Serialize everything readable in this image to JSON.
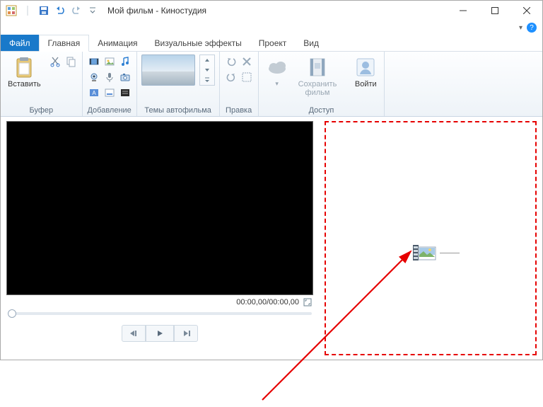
{
  "window": {
    "title": "Мой фильм - Киностудия"
  },
  "tabs": {
    "file": "Файл",
    "home": "Главная",
    "animation": "Анимация",
    "vfx": "Визуальные эффекты",
    "project": "Проект",
    "view": "Вид"
  },
  "ribbon": {
    "buffer": {
      "paste_label": "Вставить",
      "group_label": "Буфер"
    },
    "add": {
      "group_label": "Добавление"
    },
    "themes": {
      "group_label": "Темы автофильма"
    },
    "edit": {
      "group_label": "Правка"
    },
    "access": {
      "group_label": "Доступ",
      "save_label": "Сохранить\nфильм",
      "signin_label": "Войти"
    }
  },
  "player": {
    "time": "00:00,00/00:00,00"
  }
}
